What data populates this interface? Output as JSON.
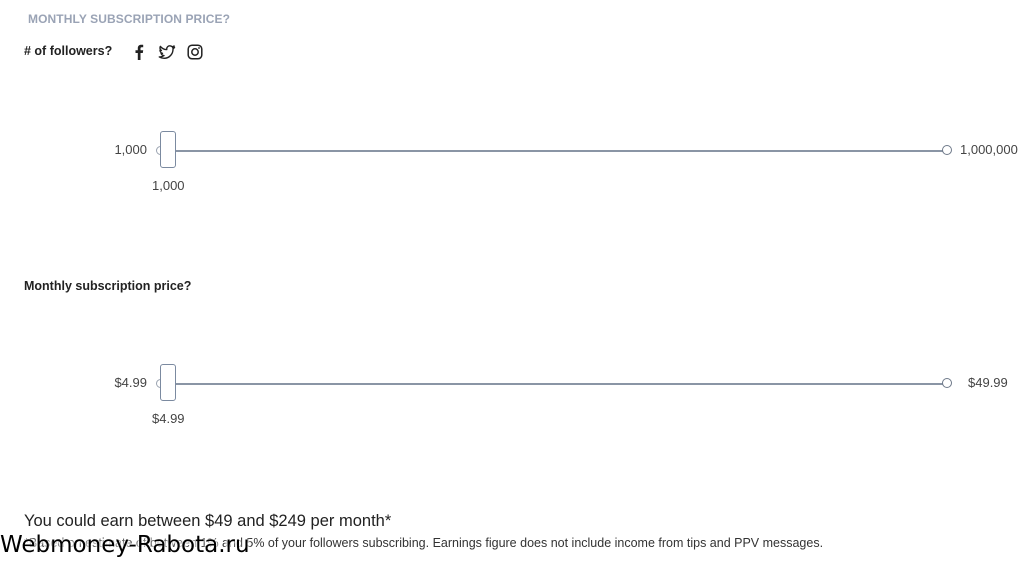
{
  "header": {
    "section_title": "MONTHLY SUBSCRIPTION PRICE?"
  },
  "followers": {
    "label": "# of followers?",
    "icons": [
      "facebook-icon",
      "twitter-icon",
      "instagram-icon"
    ],
    "slider": {
      "min_label": "1,000",
      "max_label": "1,000,000",
      "value_label": "1,000",
      "value": 1000
    }
  },
  "price": {
    "label": "Monthly subscription price?",
    "slider": {
      "min_label": "$4.99",
      "max_label": "$49.99",
      "value_label": "$4.99",
      "value": 4.99
    }
  },
  "result": {
    "headline": "You could earn between $49 and $249 per month*",
    "footnote": "*Based on estimate of between 1% and 5% of your followers subscribing. Earnings figure does not include income from tips and PPV messages."
  },
  "watermark": "Webmoney-Rabota.ru",
  "colors": {
    "track": "#8a95a5",
    "thumb_border": "#7b8aa0",
    "muted_title": "#9aa3b5"
  }
}
